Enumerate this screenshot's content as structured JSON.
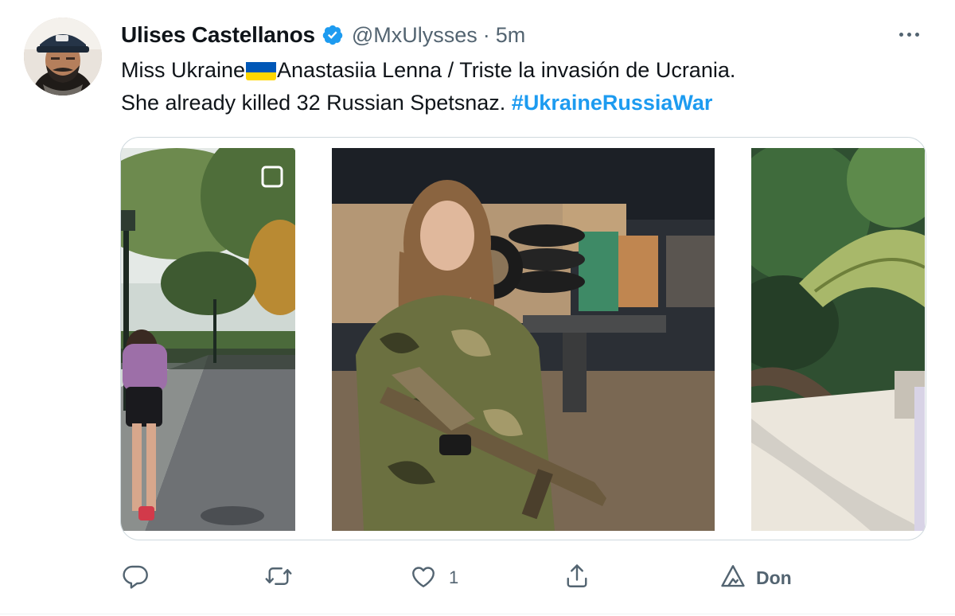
{
  "tweet": {
    "author_name": "Ulises Castellanos",
    "handle": "@MxUlysses",
    "separator": "·",
    "time": "5m",
    "text_line1_a": "Miss Ukraine",
    "text_line1_b": "Anastasiia Lenna / Triste la invasión de Ucrania.",
    "text_line2": "She already killed 32 Russian Spetsnaz. ",
    "hashtag": "#UkraineRussiaWar"
  },
  "actions": {
    "like_count": "1",
    "analytics_label": "Don"
  },
  "colors": {
    "accent": "#1d9bf0",
    "secondary_text": "#536471",
    "border": "#cfd9de",
    "flag_blue": "#0057b7",
    "flag_yellow": "#ffd700"
  },
  "icons": {
    "verified": "verified-badge-icon",
    "more": "more-dots-icon",
    "reply": "reply-icon",
    "retweet": "retweet-icon",
    "like": "heart-icon",
    "share": "share-icon",
    "analytics": "analytics-icon",
    "flag": "ukraine-flag-emoji"
  }
}
